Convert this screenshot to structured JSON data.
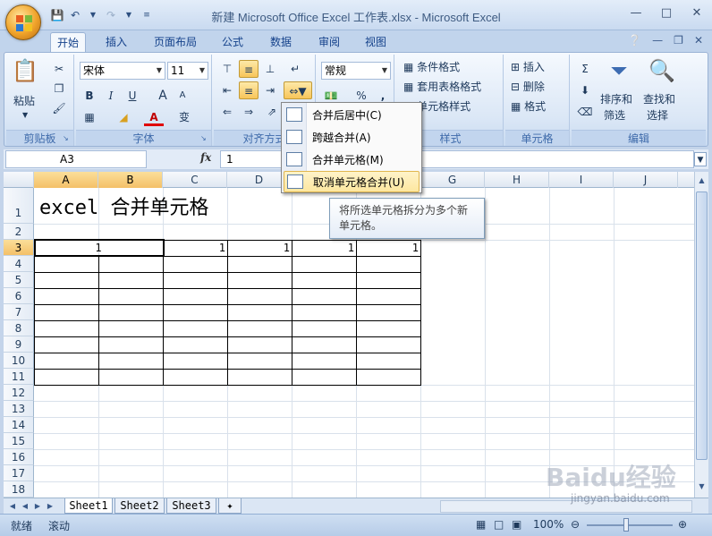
{
  "window": {
    "title": "新建 Microsoft Office Excel 工作表.xlsx - Microsoft Excel"
  },
  "tabs": [
    "开始",
    "插入",
    "页面布局",
    "公式",
    "数据",
    "审阅",
    "视图"
  ],
  "ribbon": {
    "clipboard": {
      "label": "剪贴板",
      "paste": "粘贴"
    },
    "font": {
      "label": "字体",
      "font_name": "宋体",
      "font_size": "11",
      "bold": "B",
      "italic": "I",
      "underline": "U",
      "grow": "A",
      "shrink": "A",
      "font_color": "A",
      "phonetic": "变"
    },
    "alignment": {
      "label": "对齐方式"
    },
    "number": {
      "format": "常规",
      "percent": "%",
      "comma": ","
    },
    "styles": {
      "label": "样式",
      "conditional": "条件格式",
      "table_format": "套用表格格式",
      "cell_style": "单元格样式"
    },
    "cells": {
      "label": "单元格",
      "insert": "插入",
      "delete": "删除",
      "format": "格式"
    },
    "editing": {
      "label": "编辑",
      "sort_filter_1": "排序和",
      "sort_filter_2": "筛选",
      "find_select_1": "查找和",
      "find_select_2": "选择"
    }
  },
  "formula_bar": {
    "name_box": "A3",
    "fx": "fx",
    "value": "1"
  },
  "columns": [
    "A",
    "B",
    "C",
    "D",
    "E",
    "F",
    "G",
    "H",
    "I",
    "J"
  ],
  "rows": [
    "1",
    "2",
    "3",
    "4",
    "5",
    "6",
    "7",
    "8",
    "9",
    "10",
    "11",
    "12",
    "13",
    "14",
    "15",
    "16",
    "17",
    "18"
  ],
  "sheet": {
    "title_cell": "excel 合并单元格",
    "row3_values": [
      "1",
      "1",
      "1",
      "1",
      "1"
    ]
  },
  "merge_menu": {
    "items": [
      {
        "label": "合并后居中(C)"
      },
      {
        "label": "跨越合并(A)"
      },
      {
        "label": "合并单元格(M)"
      },
      {
        "label": "取消单元格合并(U)"
      }
    ],
    "tooltip": "将所选单元格拆分为多个新单元格。"
  },
  "sheet_tabs": [
    "Sheet1",
    "Sheet2",
    "Sheet3"
  ],
  "status": {
    "ready": "就绪",
    "scroll": "滚动",
    "zoom": "100%"
  },
  "watermark": {
    "text": "Baidu经验",
    "url": "jingyan.baidu.com"
  },
  "colors": {
    "ribbon_bg": "#dbe7f6",
    "selected": "#f8c55a",
    "header_active": "#f4c068"
  }
}
